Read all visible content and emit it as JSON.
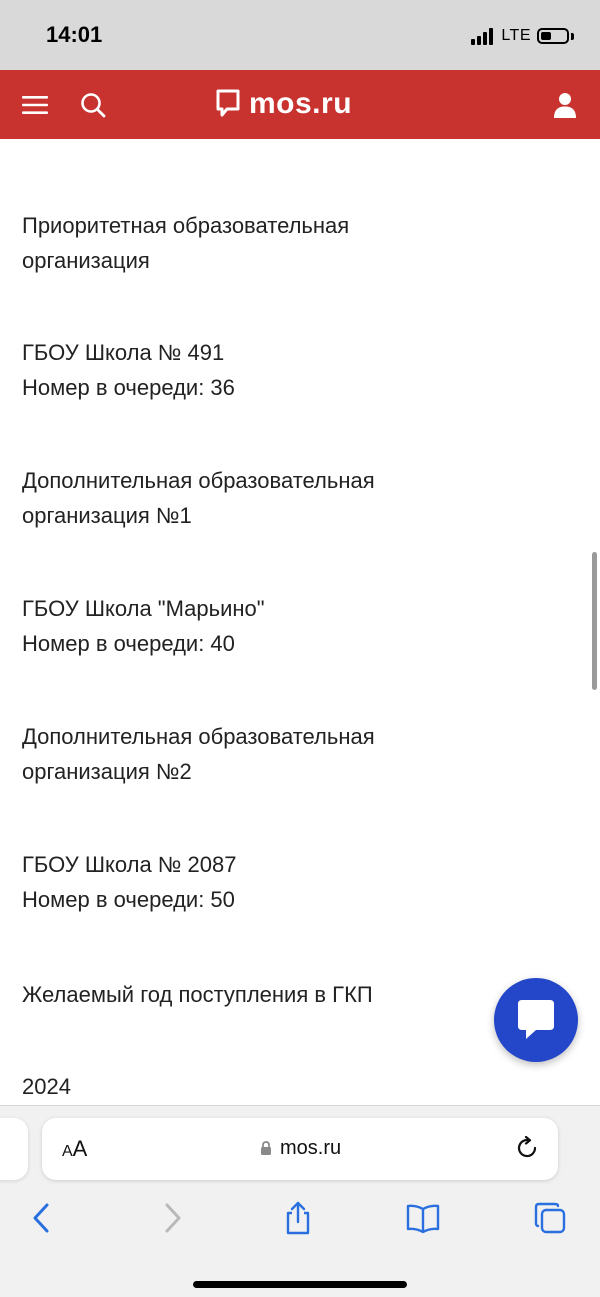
{
  "status_bar": {
    "time": "14:01",
    "network": "LTE"
  },
  "header": {
    "brand": "mos.ru",
    "brand_color": "#c8322f"
  },
  "content": {
    "items": [
      {
        "lines": [
          "Приоритетная образовательная",
          "организация"
        ]
      },
      {
        "lines": [
          "ГБОУ Школа № 491",
          "Номер в очереди: 36"
        ]
      },
      {
        "lines": [
          "Дополнительная образовательная",
          "организация №1"
        ]
      },
      {
        "lines": [
          "ГБОУ Школа \"Марьино\"",
          "Номер в очереди: 40"
        ]
      },
      {
        "lines": [
          "Дополнительная образовательная",
          "организация №2"
        ]
      },
      {
        "lines": [
          "ГБОУ Школа № 2087",
          "Номер в очереди: 50"
        ]
      },
      {
        "lines": [
          "Желаемый год поступления в ГКП"
        ]
      },
      {
        "lines": [
          "2024"
        ]
      }
    ]
  },
  "chat_button": {
    "color": "#2347c8",
    "icon": "chat-bubble-icon"
  },
  "browser": {
    "aa_small": "A",
    "aa_large": "A",
    "url": "mos.ru",
    "toolbar": [
      "back-icon",
      "forward-icon",
      "share-icon",
      "bookmarks-icon",
      "tabs-icon"
    ]
  }
}
